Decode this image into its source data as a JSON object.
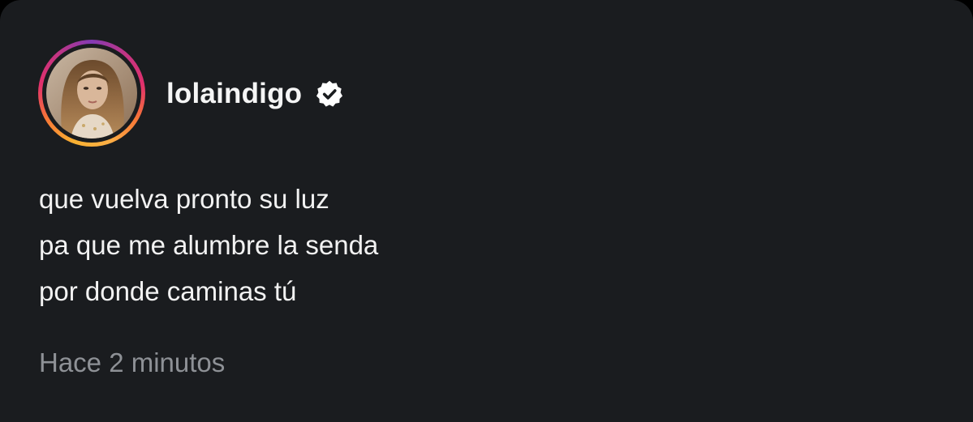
{
  "post": {
    "username": "lolaindigo",
    "verified_icon": "verified-badge-icon",
    "avatar_icon": "profile-photo",
    "lines": [
      "que vuelva pronto su luz",
      "pa que me alumbre la senda",
      "por donde caminas tú"
    ],
    "timestamp": "Hace 2 minutos"
  },
  "colors": {
    "background": "#1a1c1f",
    "text": "#f2f2f2",
    "muted_text": "#8e9196",
    "story_ring_start": "#f9b132",
    "story_ring_end": "#c13584"
  }
}
